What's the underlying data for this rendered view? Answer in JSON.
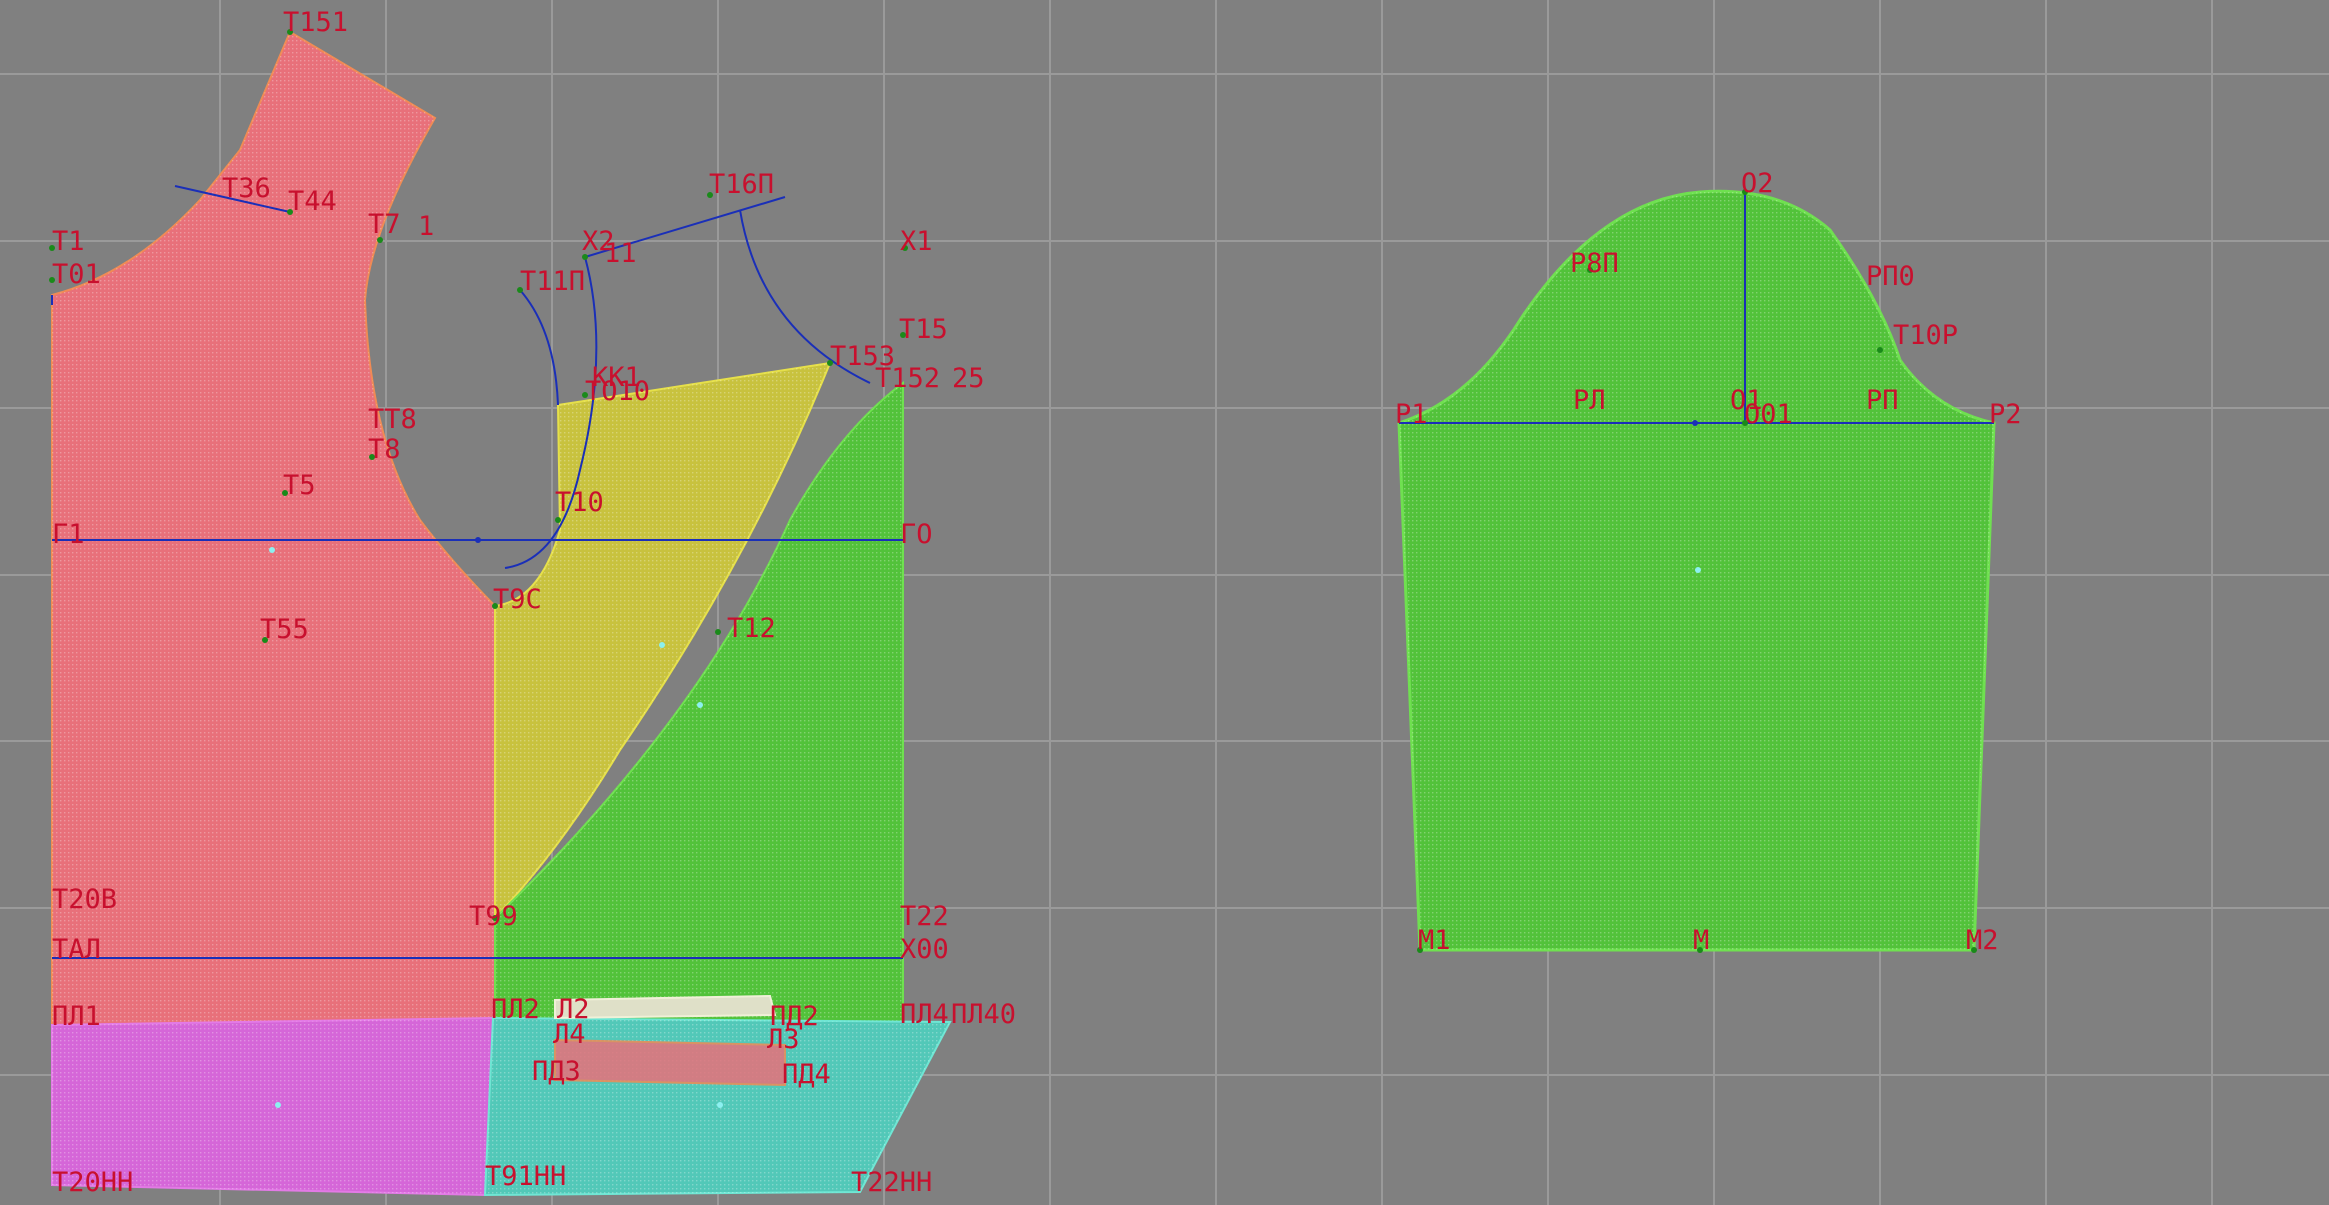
{
  "colors": {
    "background": "#808080",
    "grid": "#9a9a9a",
    "label": "#c8102e",
    "construction_line": "#1a2fb8",
    "piece_back": "#e8707a",
    "piece_side_yellow": "#c8c23e",
    "piece_front_green": "#52c23a",
    "piece_lower_magenta": "#d566d8",
    "piece_lower_cyan": "#52c8b8",
    "piece_sleeve": "#52c23a"
  },
  "labels": {
    "T151": "Т151",
    "T36": "Т36",
    "T44": "Т44",
    "T7": "Т7",
    "T71": "1",
    "T16P": "Т16П",
    "X2": "Х2",
    "I1": "11",
    "X1": "Х1",
    "T1": "Т1",
    "T01": "Т01",
    "T11P": "Т11П",
    "T15": "Т15",
    "T153": "Т153",
    "T152": "Т152",
    "T25": "25",
    "KK1": "КК1",
    "TO10": "ТО10",
    "TT8": "ТТ8",
    "T8": "Т8",
    "T5": "Т5",
    "T10": "Т10",
    "G1": "Г1",
    "GO": "ГО",
    "T9C": "Т9С",
    "T55": "Т55",
    "T12": "Т12",
    "T20V": "Т20В",
    "T99": "Т99",
    "T22": "Т22",
    "TAL": "ТАЛ",
    "X00": "Х00",
    "PL1": "ПЛ1",
    "PL2": "ПЛ2",
    "L2": "Л2",
    "L4": "Л4",
    "PD2": "ПД2",
    "L3": "Л3",
    "PL4": "ПЛ4",
    "PL40": "ПЛ40",
    "PD3": "ПД3",
    "PD4": "ПД4",
    "T20NN": "Т20НН",
    "T91NN": "Т91НН",
    "T22NN": "Т22НН",
    "O2": "О2",
    "R8P": "Р8П",
    "RP0": "РП0",
    "T10R": "Т10Р",
    "R1": "Р1",
    "RL": "РЛ",
    "O1": "О1",
    "O01": "О01",
    "RP": "РП",
    "R2": "Р2",
    "M1": "М1",
    "M": "М",
    "M2": "М2"
  }
}
